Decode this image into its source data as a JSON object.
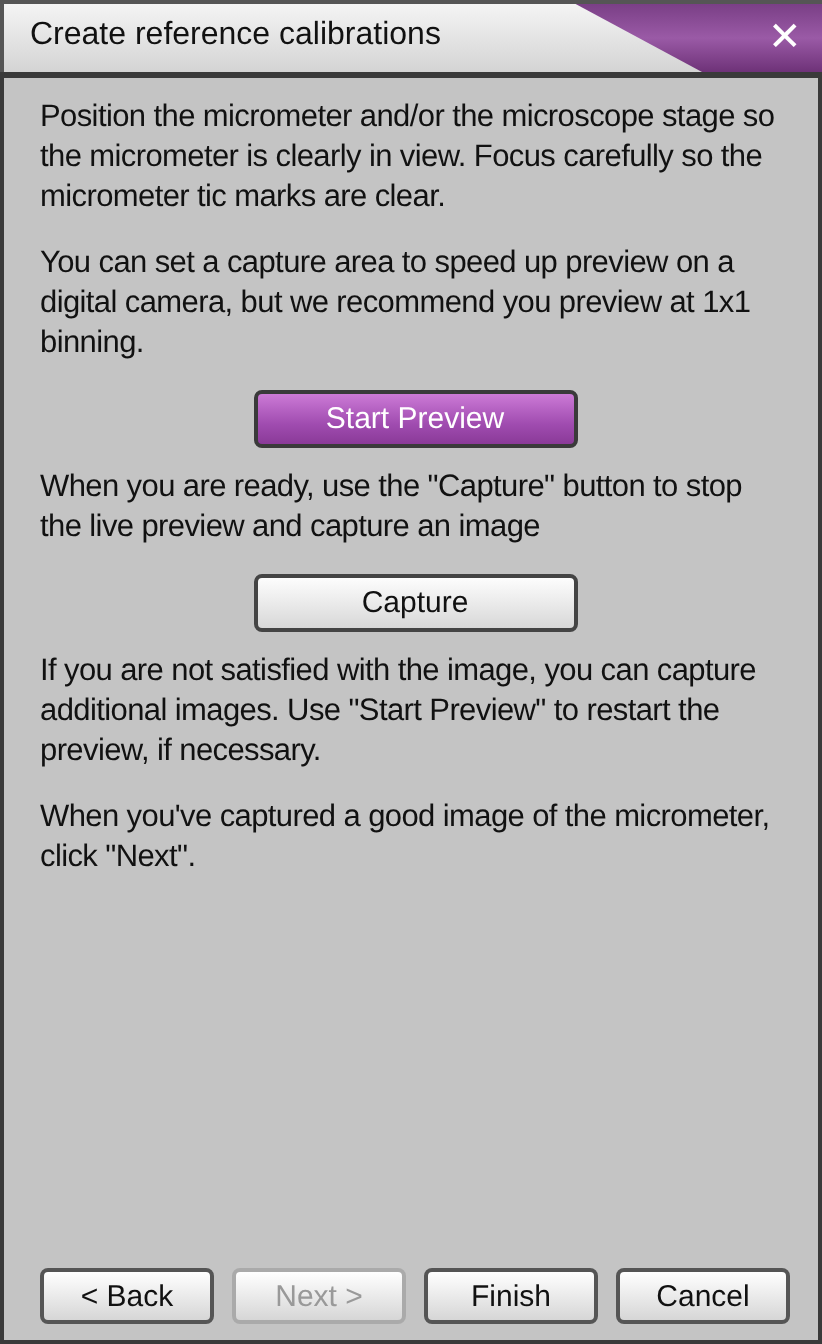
{
  "window": {
    "title": "Create reference calibrations",
    "close": "✕"
  },
  "content": [
    {
      "kind": "text",
      "text": "Position the micrometer and/or the microscope stage so the micrometer is clearly in view. Focus carefully so the micrometer tic marks are clear."
    },
    {
      "kind": "text",
      "text": "You can set a capture area to speed up preview on a digital camera, but we recommend you preview at 1x1 binning."
    },
    {
      "kind": "button",
      "label": "Start Preview",
      "primary": true
    },
    {
      "kind": "text",
      "text": "When you are ready, use the \"Capture\" button to stop the live preview and capture an image"
    },
    {
      "kind": "button",
      "label": "Capture",
      "primary": false
    },
    {
      "kind": "text",
      "text": "If you are not satisfied with the image, you can capture additional images. Use \"Start Preview\" to restart the preview, if necessary."
    },
    {
      "kind": "text",
      "text": "When you've captured a good image of the micrometer, click \"Next\"."
    }
  ],
  "buttons": [
    {
      "label": "< Back",
      "disabled": false
    },
    {
      "label": "Next >",
      "disabled": true
    },
    {
      "label": "Finish",
      "disabled": false
    },
    {
      "label": "Cancel",
      "disabled": false
    }
  ]
}
